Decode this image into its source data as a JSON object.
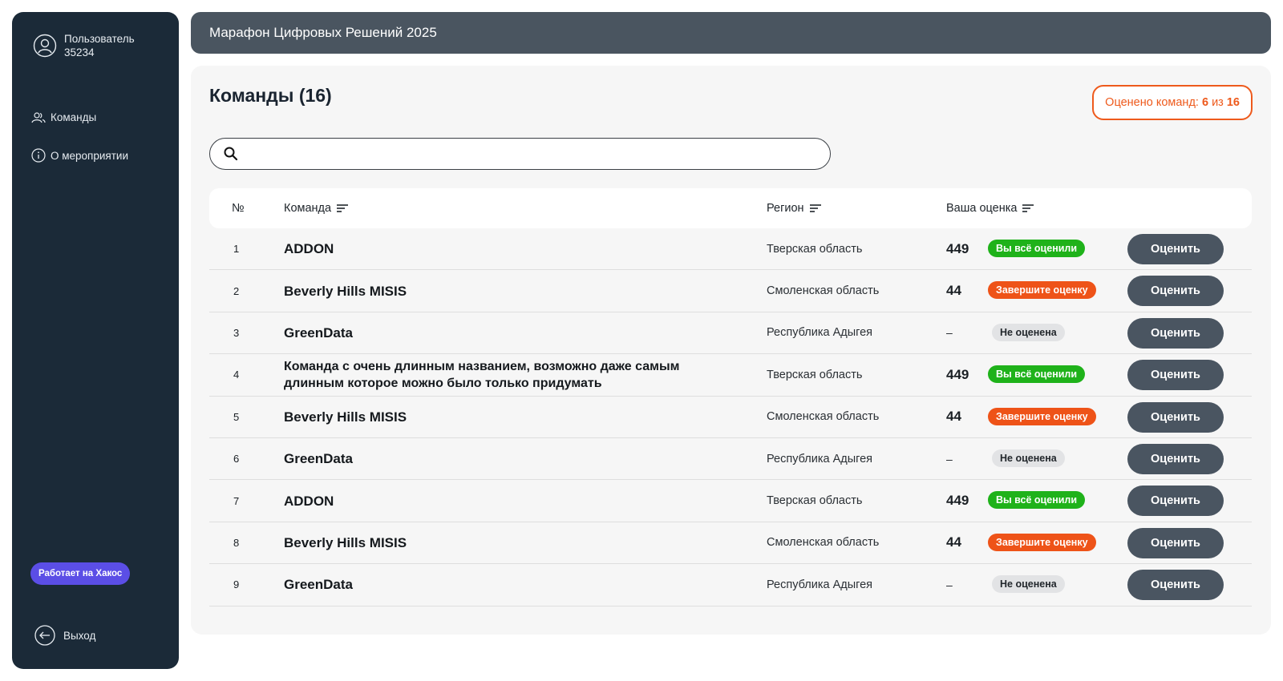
{
  "sidebar": {
    "user_name": "Пользователь 35234",
    "nav": [
      {
        "label": "Команды",
        "icon": "users-icon"
      },
      {
        "label": "О мероприятии",
        "icon": "info-icon"
      }
    ],
    "powered_by": "Работает на Хакос",
    "logout_label": "Выход"
  },
  "header": {
    "title": "Марафон Цифровых Решений 2025"
  },
  "main": {
    "title": "Команды",
    "team_count": "(16)",
    "counter": {
      "prefix": "Оценено команд:",
      "rated": "6",
      "of": "из",
      "total": "16"
    },
    "search": {
      "placeholder": "",
      "value": ""
    }
  },
  "table": {
    "columns": {
      "num": "№",
      "team": "Команда",
      "region": "Регион",
      "score": "Ваша оценка"
    },
    "rate_label": "Оценить",
    "rows": [
      {
        "num": "1",
        "team": "ADDON",
        "region": "Тверская область",
        "score": "449",
        "status": "Вы всё оценили"
      },
      {
        "num": "2",
        "team": "Beverly Hills MISIS",
        "region": "Смоленская область",
        "score": "44",
        "status": "Завершите оценку"
      },
      {
        "num": "3",
        "team": "GreenData",
        "region": "Республика Адыгея",
        "score": "–",
        "status": "Не оценена"
      },
      {
        "num": "4",
        "team": "Команда с очень длинным названием, возможно даже самым длинным которое можно было только придумать",
        "region": "Тверская область",
        "score": "449",
        "status": "Вы всё оценили"
      },
      {
        "num": "5",
        "team": "Beverly Hills MISIS",
        "region": "Смоленская область",
        "score": "44",
        "status": "Завершите оценку"
      },
      {
        "num": "6",
        "team": "GreenData",
        "region": "Республика Адыгея",
        "score": "–",
        "status": "Не оценена"
      },
      {
        "num": "7",
        "team": "ADDON",
        "region": "Тверская область",
        "score": "449",
        "status": "Вы всё оценили"
      },
      {
        "num": "8",
        "team": "Beverly Hills MISIS",
        "region": "Смоленская область",
        "score": "44",
        "status": "Завершите оценку"
      },
      {
        "num": "9",
        "team": "GreenData",
        "region": "Республика Адыгея",
        "score": "–",
        "status": "Не оценена"
      }
    ]
  },
  "colors": {
    "sidebar": "#1b2a38",
    "header": "#4a5560",
    "accent": "#ee5a1c",
    "done": "#1fb21a",
    "finish": "#ee5318",
    "button": "#4a5561"
  }
}
